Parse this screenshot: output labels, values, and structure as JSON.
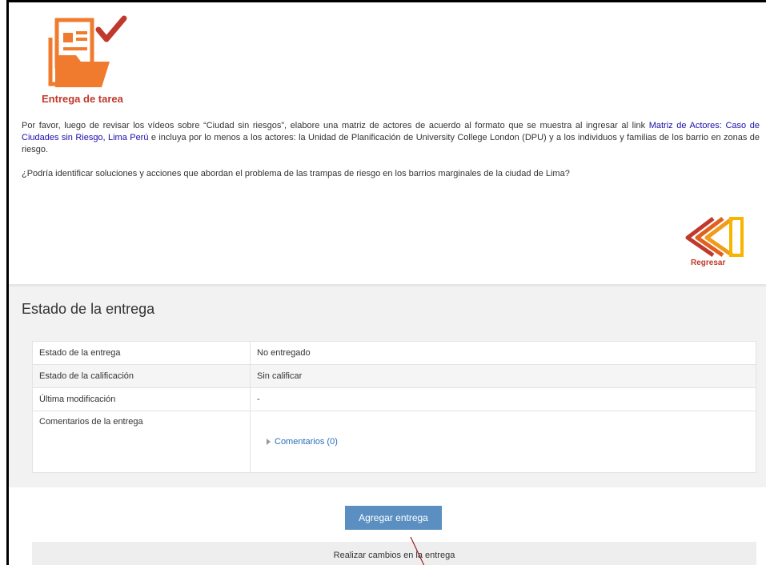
{
  "task": {
    "title": "Entrega de tarea",
    "description_before": "Por favor, luego de revisar los vídeos sobre “Ciudad sin riesgos”,  elabore una matriz de actores de acuerdo al formato que se muestra al ingresar al link ",
    "description_link": "Matriz de Actores: Caso de Ciudades sin Riesgo, Lima Perú",
    "description_after": " e incluya por lo menos a los actores: la Unidad de Planificación de University College London (DPU) y a los individuos y familias de los barrio en zonas de riesgo.",
    "question": "¿Podría identificar soluciones y acciones que abordan el problema de las trampas de riesgo en los barrios marginales de la ciudad de Lima?",
    "back_label": "Regresar"
  },
  "status": {
    "heading": "Estado de la entrega",
    "rows": [
      {
        "label": "Estado de la entrega",
        "value": "No entregado"
      },
      {
        "label": "Estado de la calificación",
        "value": "Sin calificar"
      },
      {
        "label": "Última modificación",
        "value": "-"
      },
      {
        "label": "Comentarios de la entrega",
        "value": "Comentarios (0)"
      }
    ]
  },
  "actions": {
    "add_submission": "Agregar entrega",
    "make_changes": "Realizar cambios en la entrega"
  },
  "colors": {
    "accent_red": "#c0392b",
    "icon_orange": "#f07b2e",
    "button_blue": "#5b8fc2",
    "link_blue": "#2a6fb8"
  },
  "icons": [
    "document-folder-check-icon",
    "back-arrows-icon",
    "expand-triangle-icon"
  ]
}
